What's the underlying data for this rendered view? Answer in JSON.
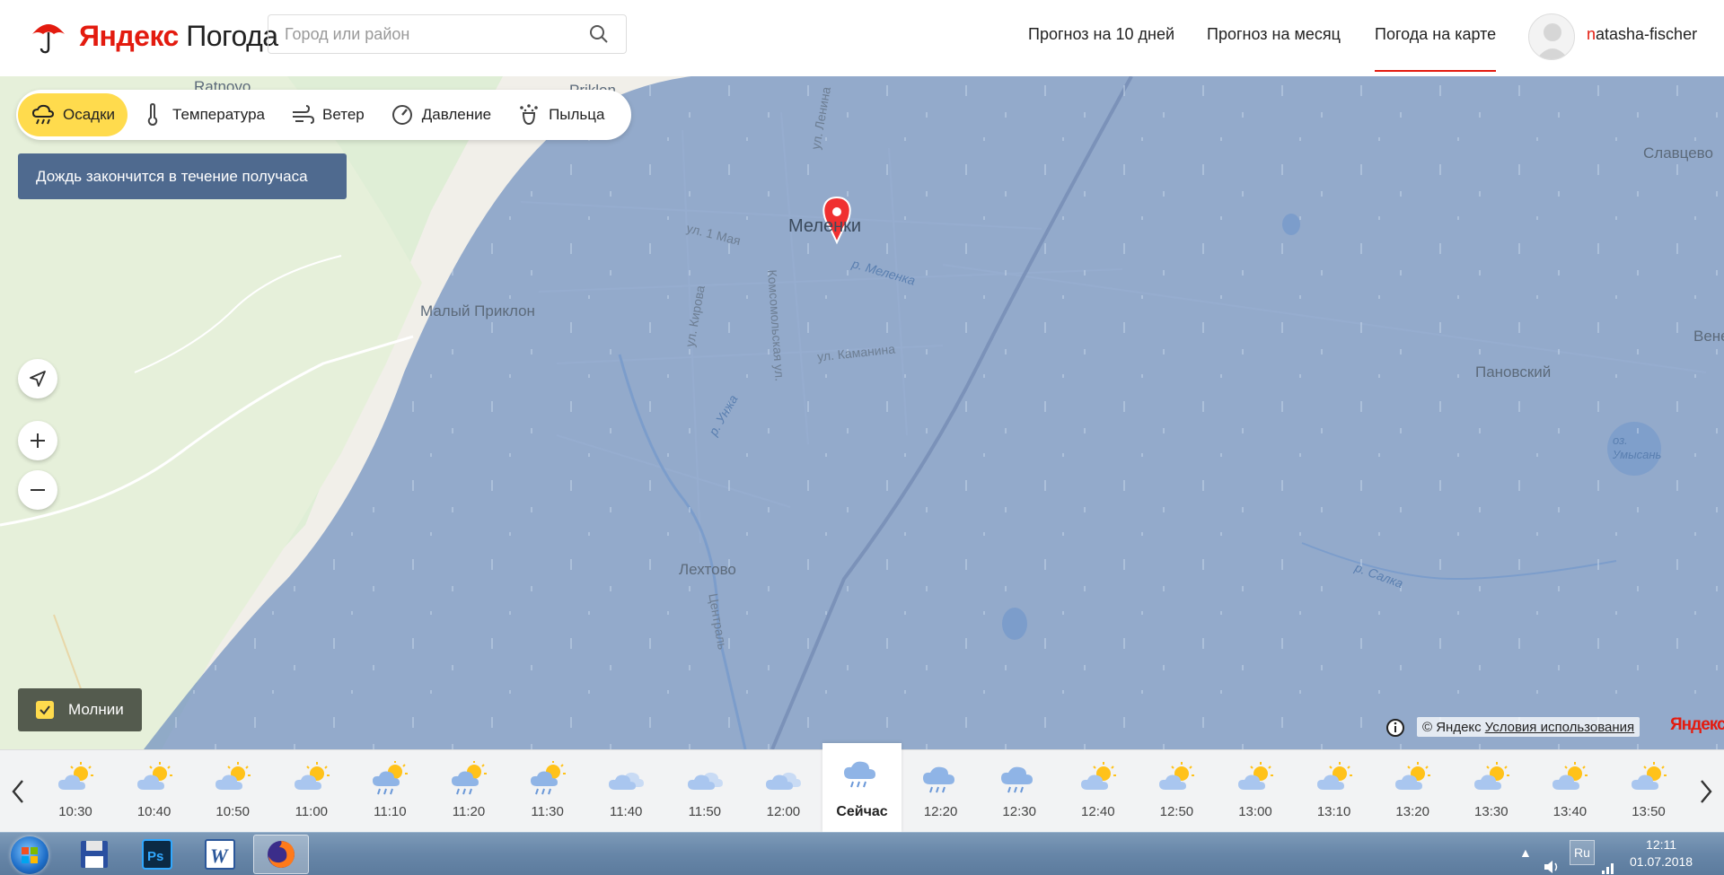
{
  "header": {
    "logo_brand": "Яндекс",
    "logo_product": "Погода",
    "search_placeholder": "Город или район",
    "nav": [
      "Прогноз на 10 дней",
      "Прогноз на месяц",
      "Погода на карте"
    ],
    "active_nav": "Погода на карте",
    "username_first": "n",
    "username_rest": "atasha-fischer"
  },
  "layers": [
    {
      "label": "Осадки",
      "icon": "cloud-rain-icon",
      "active": true
    },
    {
      "label": "Температура",
      "icon": "thermometer-icon",
      "active": false
    },
    {
      "label": "Ветер",
      "icon": "wind-icon",
      "active": false
    },
    {
      "label": "Давление",
      "icon": "gauge-icon",
      "active": false
    },
    {
      "label": "Пыльца",
      "icon": "pollen-icon",
      "active": false
    }
  ],
  "rain_message": "Дождь закончится в течение получаса",
  "lightning_label": "Молнии",
  "map_labels": {
    "ratnovo": "Ratnovo",
    "priklon": "Priklon",
    "slavtsevo": "Славцево",
    "melenki": "Меленки",
    "ul_lenina": "ул. Ленина",
    "ul_1_maya": "ул. 1 Мая",
    "ul_kirova": "ул. Кирова",
    "r_melenka": "р. Меленка",
    "malyi_priklon": "Малый Приклон",
    "komsomolskaya": "Комсомольская ул.",
    "ul_kamanina": "ул. Каманина",
    "venets": "Вене",
    "panovskiy": "Пановский",
    "oz_umysan": "оз. Умысань",
    "r_unzha": "р. Унжа",
    "r_salka": "р. Салка",
    "lekhtovo": "Лехтово",
    "tsentralnaya": "Централь"
  },
  "copyright": {
    "text": "© Яндекс",
    "link": "Условия использования",
    "mark": "Яндекс"
  },
  "timeline": [
    {
      "time": "10:30",
      "icon": "partly-cloudy-sun-icon"
    },
    {
      "time": "10:40",
      "icon": "partly-cloudy-sun-icon"
    },
    {
      "time": "10:50",
      "icon": "partly-cloudy-sun-icon"
    },
    {
      "time": "11:00",
      "icon": "partly-cloudy-sun-icon"
    },
    {
      "time": "11:10",
      "icon": "sun-cloud-rain-icon"
    },
    {
      "time": "11:20",
      "icon": "sun-cloud-rain-icon"
    },
    {
      "time": "11:30",
      "icon": "sun-cloud-rain-icon"
    },
    {
      "time": "11:40",
      "icon": "cloudy-icon"
    },
    {
      "time": "11:50",
      "icon": "cloudy-icon"
    },
    {
      "time": "12:00",
      "icon": "cloudy-icon"
    },
    {
      "time": "Сейчас",
      "icon": "cloud-rain-icon",
      "now": true
    },
    {
      "time": "12:20",
      "icon": "cloud-rain-icon"
    },
    {
      "time": "12:30",
      "icon": "cloud-rain-icon"
    },
    {
      "time": "12:40",
      "icon": "partly-cloudy-sun-icon"
    },
    {
      "time": "12:50",
      "icon": "partly-cloudy-sun-icon"
    },
    {
      "time": "13:00",
      "icon": "partly-cloudy-sun-icon"
    },
    {
      "time": "13:10",
      "icon": "partly-cloudy-sun-icon"
    },
    {
      "time": "13:20",
      "icon": "partly-cloudy-sun-icon"
    },
    {
      "time": "13:30",
      "icon": "partly-cloudy-sun-icon"
    },
    {
      "time": "13:40",
      "icon": "partly-cloudy-sun-icon"
    },
    {
      "time": "13:50",
      "icon": "partly-cloudy-sun-icon"
    }
  ],
  "taskbar": {
    "lang": "Ru",
    "time": "12:11",
    "date": "01.07.2018"
  },
  "colors": {
    "accent_yellow": "#ffdb4d",
    "brand_red": "#e31b0f",
    "rain_overlay": "#6f8fbf"
  }
}
